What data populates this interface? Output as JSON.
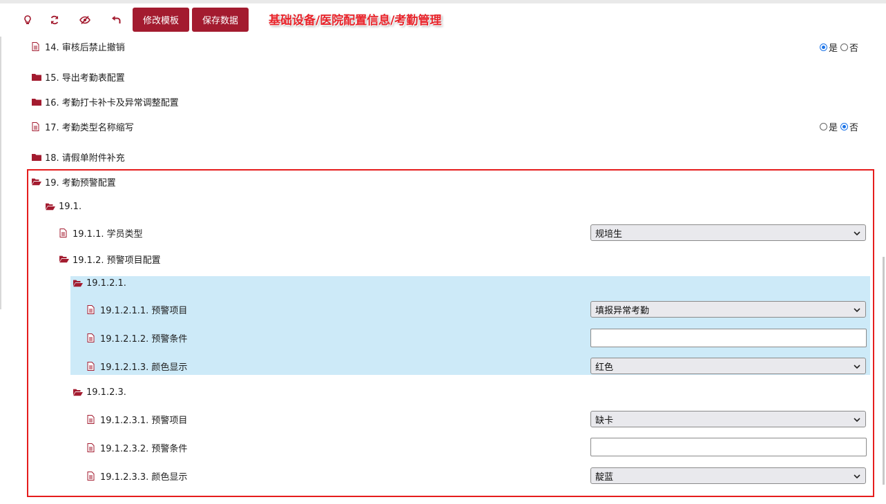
{
  "toolbar": {
    "buttons": {
      "edit_template": "修改模板",
      "save_data": "保存数据"
    },
    "icons": [
      "lightbulb-icon",
      "refresh-icon",
      "eye-slash-icon",
      "undo-icon"
    ]
  },
  "breadcrumb": "基础设备/医院配置信息/考勤管理",
  "colors": {
    "accent": "#a31b2f",
    "radio_selected": "#1a73e8",
    "highlight": "#cdeaf8",
    "annotation_box": "#e51c1c"
  },
  "rows": {
    "r14": {
      "label": "14. 审核后禁止撤销",
      "yes": "是",
      "no": "否",
      "selected": "是"
    },
    "r15": {
      "label": "15. 导出考勤表配置"
    },
    "r16": {
      "label": "16. 考勤打卡补卡及异常调整配置"
    },
    "r17": {
      "label": "17. 考勤类型名称缩写",
      "yes": "是",
      "no": "否",
      "selected": "否"
    },
    "r18": {
      "label": "18. 请假单附件补充"
    },
    "r19": {
      "label": "19. 考勤预警配置"
    },
    "r19_1": {
      "label": "19.1."
    },
    "r19_1_1": {
      "label": "19.1.1. 学员类型",
      "value": "规培生"
    },
    "r19_1_2": {
      "label": "19.1.2. 预警项目配置"
    },
    "r19_1_2_1": {
      "label": "19.1.2.1."
    },
    "r19_1_2_1_1": {
      "label": "19.1.2.1.1. 预警项目",
      "value": "填报异常考勤"
    },
    "r19_1_2_1_2": {
      "label": "19.1.2.1.2. 预警条件",
      "value": ""
    },
    "r19_1_2_1_3": {
      "label": "19.1.2.1.3. 颜色显示",
      "value": "红色"
    },
    "r19_1_2_3": {
      "label": "19.1.2.3."
    },
    "r19_1_2_3_1": {
      "label": "19.1.2.3.1. 预警项目",
      "value": "缺卡"
    },
    "r19_1_2_3_2": {
      "label": "19.1.2.3.2. 预警条件",
      "value": ""
    },
    "r19_1_2_3_3": {
      "label": "19.1.2.3.3. 颜色显示",
      "value": "靛蓝"
    }
  }
}
